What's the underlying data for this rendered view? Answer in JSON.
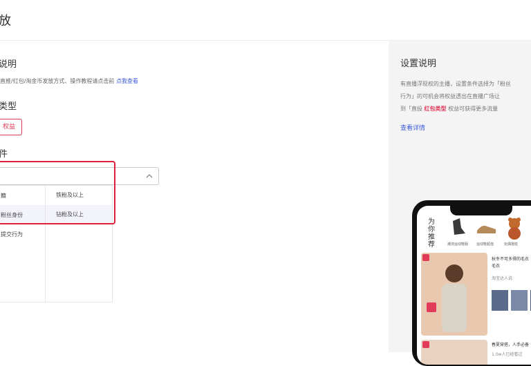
{
  "header": {
    "title": "放"
  },
  "main": {
    "section_desc_title": "说明",
    "description_text": "直推/红包/淘金币发放方式、操作教程请点击前",
    "description_link": "点我查看",
    "section_type_title": "类型",
    "type_chip": "权益",
    "section_condition_title": "件",
    "dropdown": {
      "left_options": [
        "籍",
        "粉丝身份",
        "提交行为"
      ],
      "right_options": [
        "铁粉及以上",
        "钻粉及以上"
      ]
    }
  },
  "side": {
    "title": "设置说明",
    "lines": [
      "有直播浮现权的主播，设置条件选择为「粉丝",
      "行为」的可机会将权益透出在直播广场让"
    ],
    "line3_prefix": "到「直投",
    "line3_highlight": "红包类型",
    "line3_suffix": "权益可获得更多流量",
    "detail_link": "查看详情",
    "phone": {
      "rec_title": "为你推荐",
      "products": [
        "潮流运动鞋服",
        "运动鞋超值",
        "玩偶抱枕"
      ],
      "card_title_1": "秋冬不可多得的毛衣",
      "card_title_2": "毛衣",
      "card_author": "淘宝达人说",
      "card2_title": "春夏穿搭，人手必备",
      "card2_meta": "1.0w人已经看过"
    }
  }
}
